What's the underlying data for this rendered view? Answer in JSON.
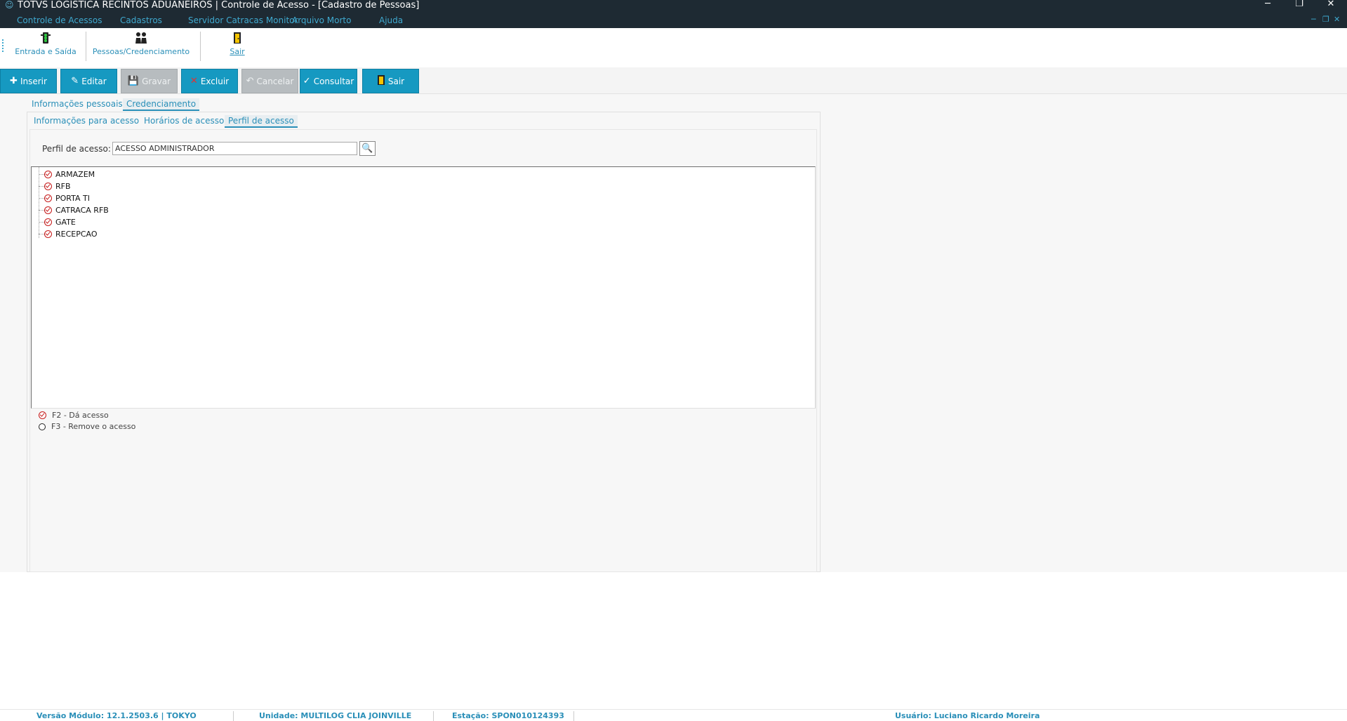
{
  "window": {
    "title": "TOTVS LOGÍSTICA RECINTOS ADUANEIROS | Controle de Acesso - [Cadastro de Pessoas]",
    "minimize": "─",
    "restore": "❐",
    "close": "✕",
    "mdi_minimize": "─",
    "mdi_restore": "❐",
    "mdi_close": "✕"
  },
  "menu": {
    "items": [
      "Controle de Acessos",
      "Cadastros",
      "Servidor Catracas Monitor",
      "Arquivo Morto",
      "Ajuda"
    ]
  },
  "ribbon": {
    "items": [
      {
        "label": "Entrada e Saída",
        "icon": "traffic-light-icon"
      },
      {
        "label": "Pessoas/Credenciamento",
        "icon": "people-icon"
      },
      {
        "label": "Sair",
        "icon": "exit-door-icon"
      }
    ]
  },
  "actions": {
    "inserir": "Inserir",
    "editar": "Editar",
    "gravar": "Gravar",
    "excluir": "Excluir",
    "cancelar": "Cancelar",
    "consultar": "Consultar",
    "sair": "Sair"
  },
  "tabs": {
    "outer": [
      "Informações pessoais",
      "Credenciamento"
    ],
    "outer_active": "Credenciamento",
    "inner": [
      "Informações para acesso",
      "Horários de acesso",
      "Perfil de acesso"
    ],
    "inner_active": "Perfil de acesso"
  },
  "perfil": {
    "label": "Perfil de acesso:",
    "value": "ACESSO ADMINISTRADOR"
  },
  "tree": {
    "items": [
      "ARMAZEM",
      "RFB",
      "PORTA TI",
      "CATRACA RFB",
      "GATE",
      "RECEPCAO"
    ]
  },
  "legend": {
    "grant": "F2 - Dá acesso",
    "remove": "F3 - Remove o acesso"
  },
  "status": {
    "version": "Versão Módulo:  12.1.2503.6  |  TOKYO",
    "unit": "Unidade: MULTILOG CLIA JOINVILLE",
    "station": "Estação: SPON010124393",
    "user": "Usuário: Luciano Ricardo Moreira"
  },
  "colors": {
    "titlebar": "#1e2a33",
    "accent": "#1699c1",
    "disabled": "#b7bcbf",
    "check_red": "#c61a1a"
  }
}
